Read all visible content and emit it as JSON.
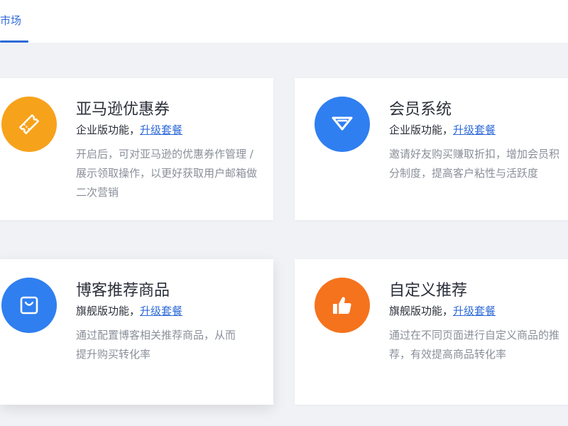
{
  "header": {
    "tab_label": "市场"
  },
  "cards": [
    {
      "title": "亚马逊优惠券",
      "edition_prefix": "企业版功能，",
      "upgrade_label": "升级套餐",
      "description": "开启后，可对亚马逊的优惠券作管理 / 展示领取操作，以更好获取用户邮箱做二次营销",
      "icon": "ticket-icon",
      "icon_color": "#f7a21b"
    },
    {
      "title": "会员系统",
      "edition_prefix": "企业版功能，",
      "upgrade_label": "升级套餐",
      "description": "邀请好友购买赚取折扣，增加会员积分制度，提高客户粘性与活跃度",
      "icon": "diamond-icon",
      "icon_color": "#2f7ff0"
    },
    {
      "title": "博客推荐商品",
      "edition_prefix": "旗舰版功能，",
      "upgrade_label": "升级套餐",
      "description": "通过配置博客相关推荐商品，从而提升购买转化率",
      "icon": "shopping-bag-icon",
      "icon_color": "#2f7ff0"
    },
    {
      "title": "自定义推荐",
      "edition_prefix": "旗舰版功能，",
      "upgrade_label": "升级套餐",
      "description": "通过在不同页面进行自定义商品的推荐，有效提高商品转化率",
      "icon": "thumbs-up-icon",
      "icon_color": "#f5731d"
    }
  ]
}
